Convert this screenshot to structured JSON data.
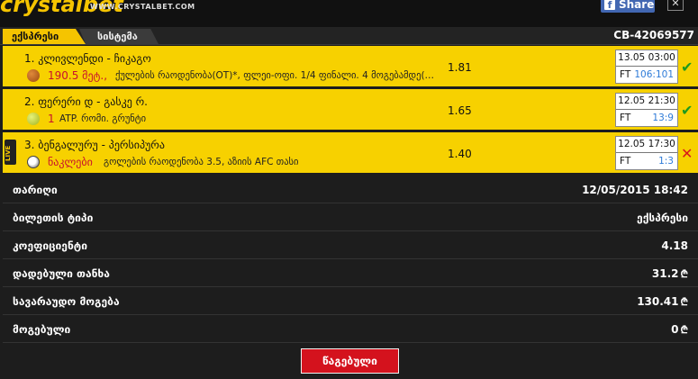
{
  "header": {
    "logo_text": "crystalbet",
    "logo_sub": "WWW.CRYSTALBET.COM",
    "share_label": "Share",
    "fb_icon": "f",
    "close_icon": "✕"
  },
  "tabs": [
    {
      "label": "ექსპრესი",
      "active": true
    },
    {
      "label": "სისტემა",
      "active": false
    }
  ],
  "ticket_id": "CB-42069577",
  "bets": [
    {
      "title": "1. კლივლენდი - ჩიკაგო",
      "sport_icon": "basketball-icon",
      "stake": "190.5 მეტ.,",
      "description": "ქულების რაოდენობა(OT)*, ფლეი-ოფი. 1/4 ფინალი. 4 მოგებამდე(…",
      "odds": "1.81",
      "date": "13.05 03:00",
      "period": "FT",
      "score": "106:101",
      "status": "won",
      "status_icon": "✔",
      "live": false
    },
    {
      "title": "2. ფერერი დ - გასკე რ.",
      "sport_icon": "tennis-ball-icon",
      "stake": "1",
      "description": "ATP. რომი. გრუნტი",
      "odds": "1.65",
      "date": "12.05 21:30",
      "period": "FT",
      "score": "13:9",
      "status": "won",
      "status_icon": "✔",
      "live": false
    },
    {
      "title": "3. ბენგალურუ - პერსიპურა",
      "sport_icon": "soccer-ball-icon",
      "stake": "ნაკლები",
      "description": "გოლების რაოდენობა 3.5, აზიის AFC თასი",
      "odds": "1.40",
      "date": "12.05 17:30",
      "period": "FT",
      "score": "1:3",
      "status": "lost",
      "status_icon": "✕",
      "live": true,
      "live_label": "LIVE"
    }
  ],
  "details": {
    "date_label": "თარიღი",
    "date_value": "12/05/2015 18:42",
    "type_label": "ბილეთის ტიპი",
    "type_value": "ექსპრესი",
    "coef_label": "კოეფიციენტი",
    "coef_value": "4.18",
    "stake_label": "დადებული თანხა",
    "stake_value": "31.2",
    "expected_label": "სავარაუდო მოგება",
    "expected_value": "130.41",
    "win_label": "მოგებული",
    "win_value": "0",
    "currency_symbol": "₾"
  },
  "lost_button_label": "წაგებული",
  "colors": {
    "accent": "#f7d100",
    "won": "#1e9a1e",
    "lost": "#d9161c",
    "score": "#2e7bd8",
    "stake": "#c8102e"
  }
}
